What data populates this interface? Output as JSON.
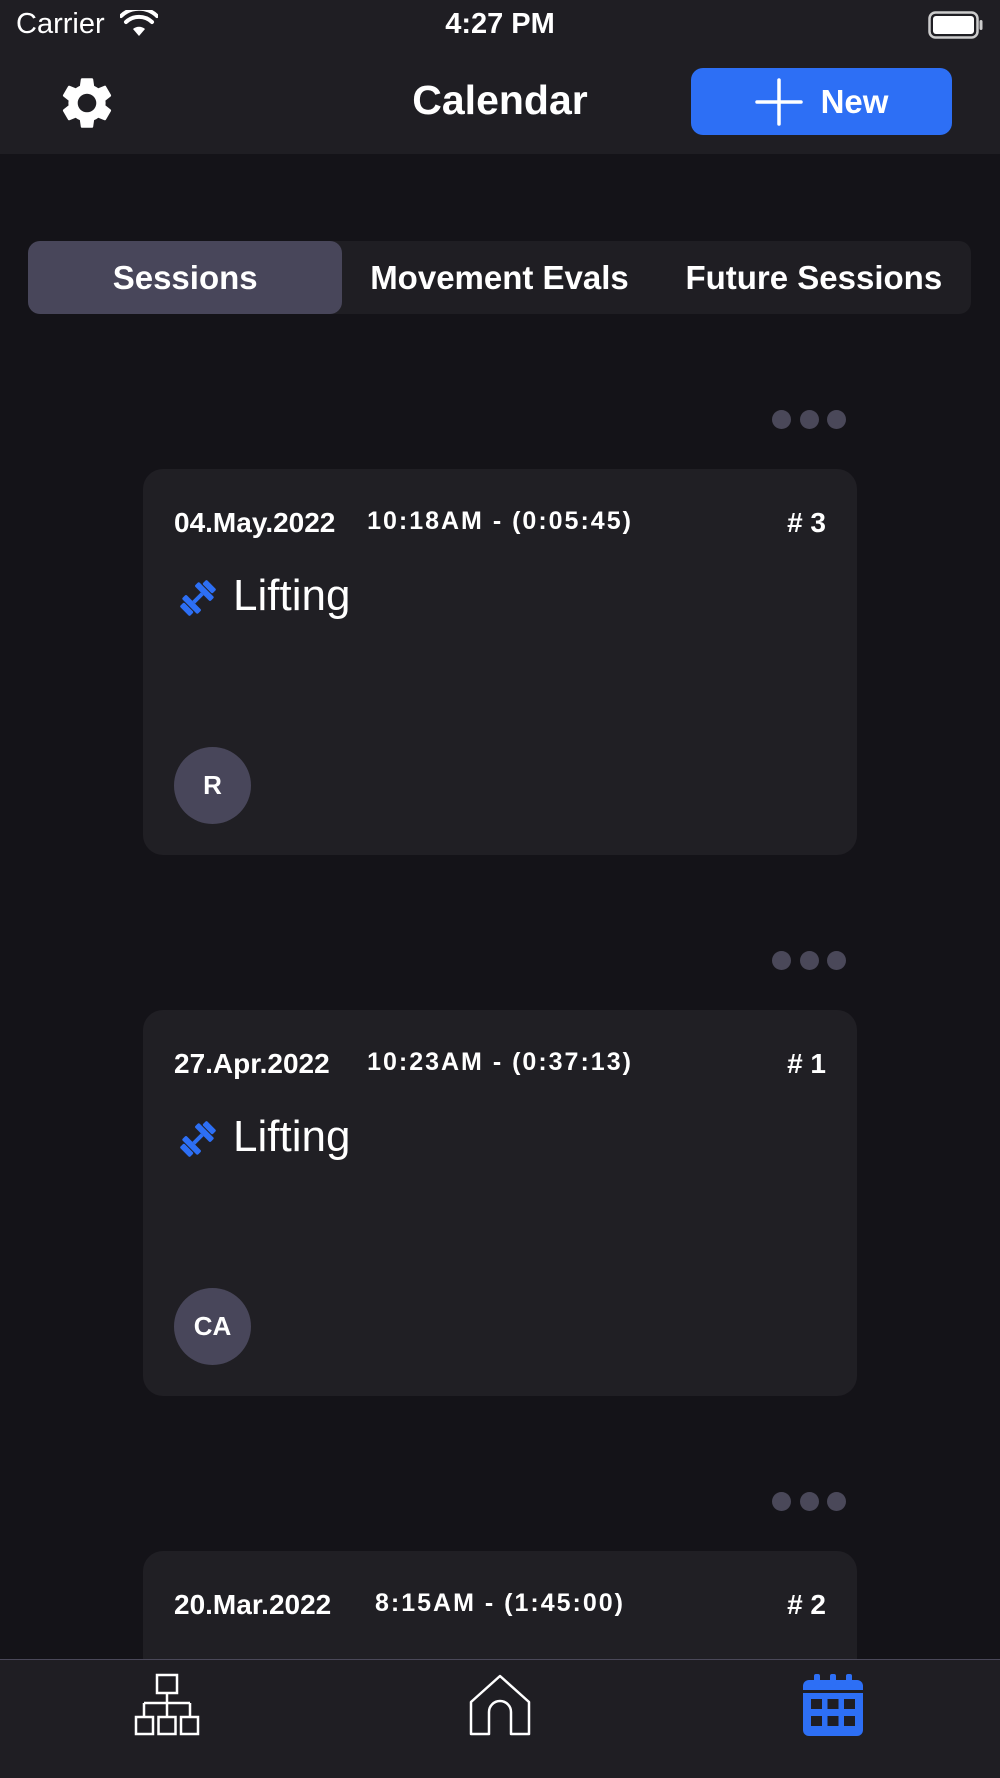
{
  "status": {
    "carrier": "Carrier",
    "time": "4:27 PM"
  },
  "nav": {
    "title": "Calendar",
    "new_label": "New"
  },
  "tabs": [
    "Sessions",
    "Movement Evals",
    "Future Sessions"
  ],
  "sessions": [
    {
      "date": "04.May.2022",
      "time": "10:18AM - (0:05:45)",
      "number": "# 3",
      "type": "Lifting",
      "avatar": "R"
    },
    {
      "date": "27.Apr.2022",
      "time": "10:23AM - (0:37:13)",
      "number": "# 1",
      "type": "Lifting",
      "avatar": "CA"
    },
    {
      "date": "20.Mar.2022",
      "time": "8:15AM - (1:45:00)",
      "number": "# 2",
      "type": "",
      "avatar": ""
    }
  ],
  "colors": {
    "accent": "#2d6ff5",
    "background": "#141318",
    "surface": "#201f24",
    "chip": "#48465a"
  },
  "icons": {
    "settings": "gear-icon",
    "new": "plus-icon",
    "session_type": "dumbbell-icon",
    "tab_hierarchy": "hierarchy-icon",
    "tab_home": "home-icon",
    "tab_calendar": "calendar-icon"
  }
}
